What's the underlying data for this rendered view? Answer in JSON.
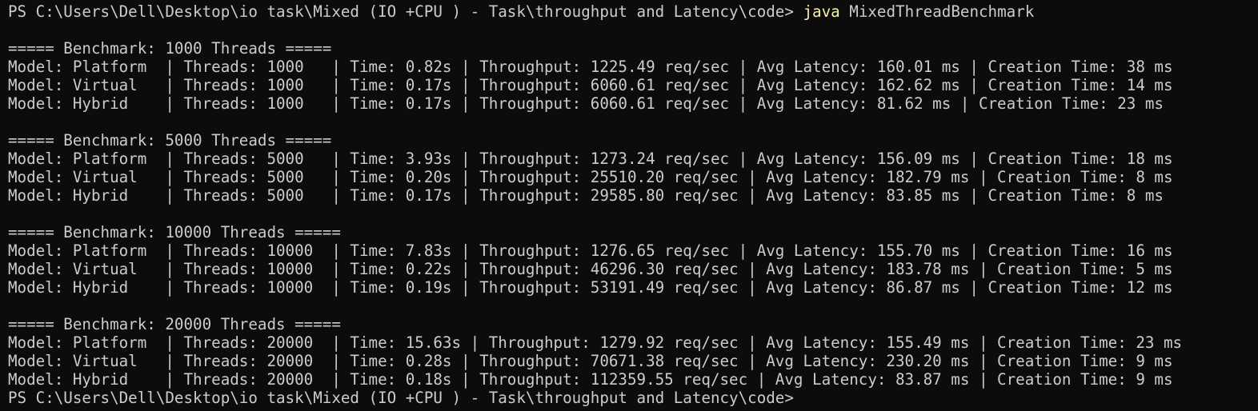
{
  "terminal": {
    "prompt": "PS C:\\Users\\Dell\\Desktop\\io task\\Mixed (IO +CPU ) - Task\\throughput and Latency\\code>",
    "command_keyword": "java",
    "command_args": "MixedThreadBenchmark",
    "lines": [
      "",
      "===== Benchmark: 1000 Threads =====",
      "Model: Platform  | Threads: 1000   | Time: 0.82s | Throughput: 1225.49 req/sec | Avg Latency: 160.01 ms | Creation Time: 38 ms",
      "Model: Virtual   | Threads: 1000   | Time: 0.17s | Throughput: 6060.61 req/sec | Avg Latency: 162.62 ms | Creation Time: 14 ms",
      "Model: Hybrid    | Threads: 1000   | Time: 0.17s | Throughput: 6060.61 req/sec | Avg Latency: 81.62 ms | Creation Time: 23 ms",
      "",
      "===== Benchmark: 5000 Threads =====",
      "Model: Platform  | Threads: 5000   | Time: 3.93s | Throughput: 1273.24 req/sec | Avg Latency: 156.09 ms | Creation Time: 18 ms",
      "Model: Virtual   | Threads: 5000   | Time: 0.20s | Throughput: 25510.20 req/sec | Avg Latency: 182.79 ms | Creation Time: 8 ms",
      "Model: Hybrid    | Threads: 5000   | Time: 0.17s | Throughput: 29585.80 req/sec | Avg Latency: 83.85 ms | Creation Time: 8 ms",
      "",
      "===== Benchmark: 10000 Threads =====",
      "Model: Platform  | Threads: 10000  | Time: 7.83s | Throughput: 1276.65 req/sec | Avg Latency: 155.70 ms | Creation Time: 16 ms",
      "Model: Virtual   | Threads: 10000  | Time: 0.22s | Throughput: 46296.30 req/sec | Avg Latency: 183.78 ms | Creation Time: 5 ms",
      "Model: Hybrid    | Threads: 10000  | Time: 0.19s | Throughput: 53191.49 req/sec | Avg Latency: 86.87 ms | Creation Time: 12 ms",
      "",
      "===== Benchmark: 20000 Threads =====",
      "Model: Platform  | Threads: 20000  | Time: 15.63s | Throughput: 1279.92 req/sec | Avg Latency: 155.49 ms | Creation Time: 23 ms",
      "Model: Virtual   | Threads: 20000  | Time: 0.28s | Throughput: 70671.38 req/sec | Avg Latency: 230.20 ms | Creation Time: 9 ms",
      "Model: Hybrid    | Threads: 20000  | Time: 0.18s | Throughput: 112359.55 req/sec | Avg Latency: 83.87 ms | Creation Time: 9 ms"
    ],
    "final_prompt": "PS C:\\Users\\Dell\\Desktop\\io task\\Mixed (IO +CPU ) - Task\\throughput and Latency\\code>",
    "colors": {
      "background": "#0c0c0c",
      "text": "#cccccc",
      "command": "#f9f1a5"
    }
  }
}
